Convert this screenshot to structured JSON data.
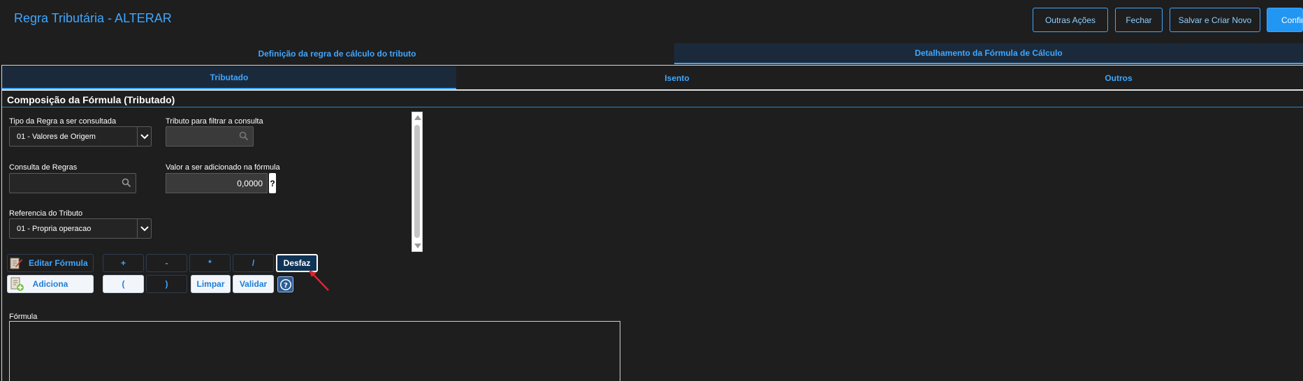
{
  "header": {
    "title": "Regra Tributária - ALTERAR",
    "buttons": {
      "outras_acoes": "Outras Ações",
      "fechar": "Fechar",
      "salvar_criar": "Salvar e Criar Novo",
      "confirmar": "Confirm"
    }
  },
  "main_tabs": [
    {
      "label": "Definição da regra de cálculo do tributo",
      "active": false
    },
    {
      "label": "Detalhamento da Fórmula de Cálculo",
      "active": true
    }
  ],
  "sub_tabs": [
    {
      "label": "Tributado",
      "active": true
    },
    {
      "label": "Isento",
      "active": false
    },
    {
      "label": "Outros",
      "active": false
    }
  ],
  "section": {
    "title": "Composição da Fórmula (Tributado)"
  },
  "form": {
    "tipo_regra": {
      "label": "Tipo da Regra a ser consultada",
      "value": "01 - Valores de Origem"
    },
    "tributo_filtro": {
      "label": "Tributo para filtrar a consulta",
      "value": ""
    },
    "consulta_regras": {
      "label": "Consulta de Regras",
      "value": ""
    },
    "valor_adicionado": {
      "label": "Valor a ser adicionado na fórmula",
      "value": "0,0000",
      "help": "?"
    },
    "referencia_tributo": {
      "label": "Referencia do Tributo",
      "value": "01 - Propria operacao"
    }
  },
  "formula_buttons": {
    "editar": "Editar Fórmula",
    "adiciona": "Adiciona",
    "plus": "+",
    "minus": "-",
    "multiply": "*",
    "divide": "/",
    "open_paren": "(",
    "close_paren": ")",
    "limpar": "Limpar",
    "validar": "Validar",
    "desfaz": "Desfaz"
  },
  "formula": {
    "label": "Fórmula",
    "value": ""
  },
  "colors": {
    "background": "#1e1e1f",
    "accent": "#3fa7ff",
    "primary_button": "#2196f3",
    "active_tab": "#1b2a3b",
    "annotation_arrow": "#e3222b"
  },
  "icons": [
    "search-icon",
    "chevron-down-icon",
    "edit-formula-icon",
    "add-document-icon",
    "help-icon"
  ]
}
